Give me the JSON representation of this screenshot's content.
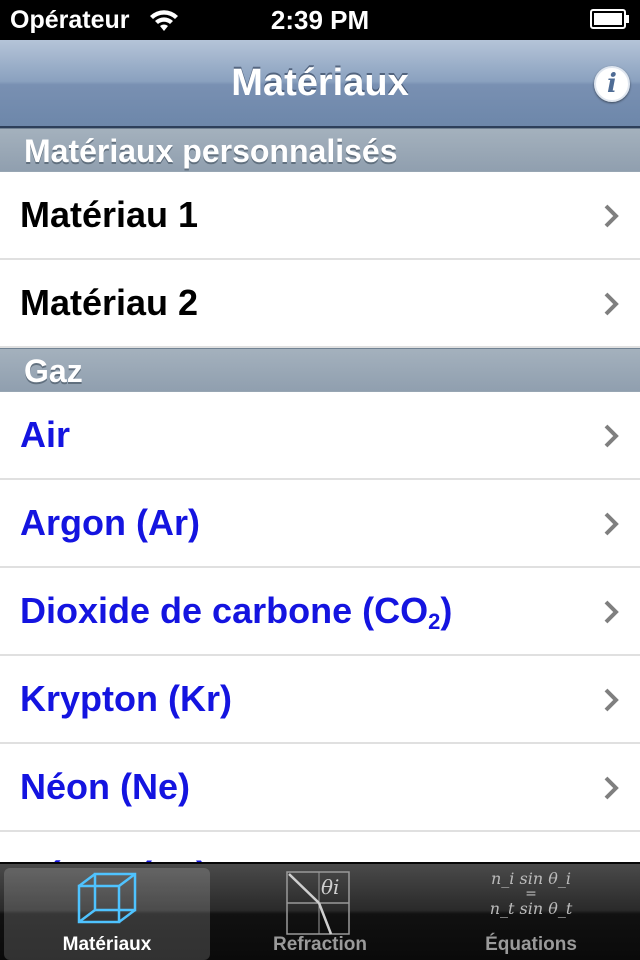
{
  "status_bar": {
    "carrier": "Opérateur",
    "time": "2:39 PM"
  },
  "nav_bar": {
    "title": "Matériaux",
    "info_button": "info-icon"
  },
  "sections": [
    {
      "header": "Matériaux personnalisés",
      "rows": [
        {
          "label": "Matériau 1"
        },
        {
          "label": "Matériau 2"
        }
      ]
    },
    {
      "header": "Gaz",
      "rows": [
        {
          "label": "Air"
        },
        {
          "label": "Argon (Ar)"
        },
        {
          "label_main": "Dioxide de carbone (CO",
          "label_sub": "2",
          "label_end": ")"
        },
        {
          "label": "Krypton (Kr)"
        },
        {
          "label": "Néon (Ne)"
        },
        {
          "label": "Xénon (Xe)"
        }
      ]
    }
  ],
  "tab_bar": {
    "tabs": [
      {
        "label": "Matériaux",
        "icon": "cube-icon",
        "selected": true
      },
      {
        "label": "Refraction",
        "icon": "refraction-icon",
        "icon_text": "θi",
        "selected": false
      },
      {
        "label": "Équations",
        "icon": "snell-equation-icon",
        "eq_top": "n_i sin θ_i",
        "eq_mid": "=",
        "eq_bottom": "n_t sin θ_t",
        "selected": false
      }
    ]
  },
  "colors": {
    "gas_label": "#1414e0",
    "custom_label": "#000000",
    "nav_bar": "#7990b2"
  }
}
